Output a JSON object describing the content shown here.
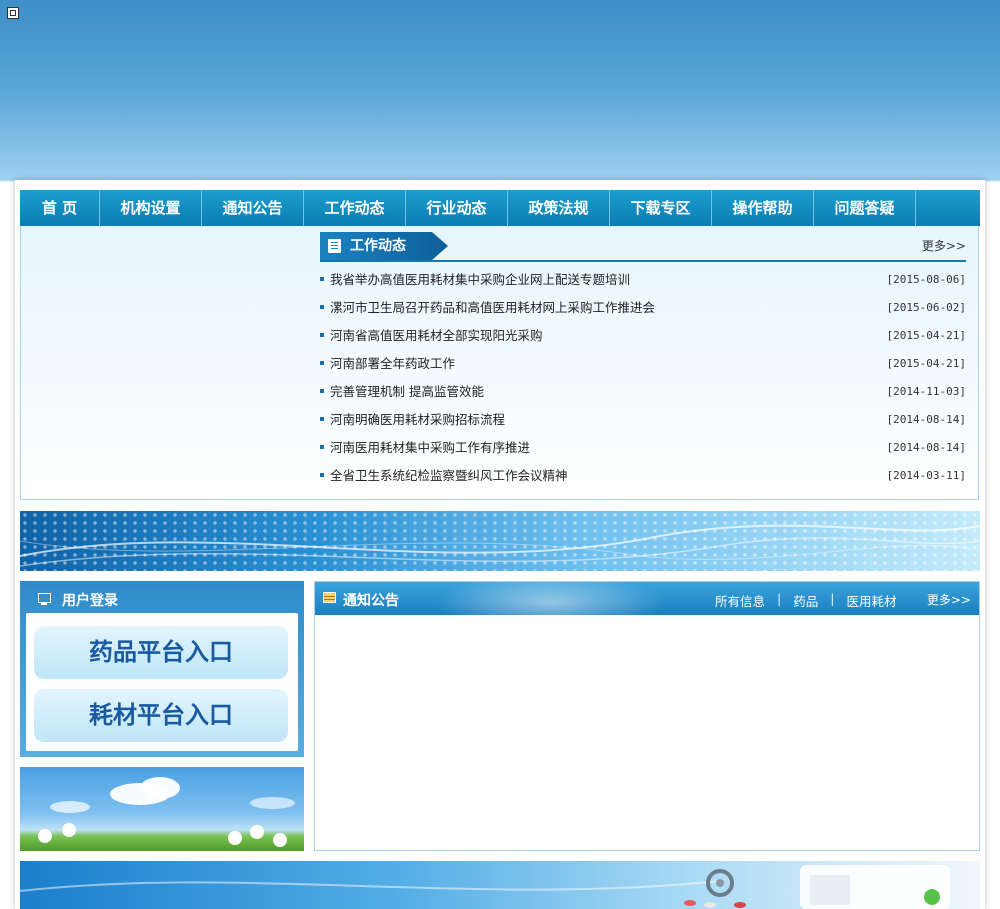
{
  "nav": {
    "items": [
      "首 页",
      "机构设置",
      "通知公告",
      "工作动态",
      "行业动态",
      "政策法规",
      "下载专区",
      "操作帮助",
      "问题答疑"
    ]
  },
  "news": {
    "title": "工作动态",
    "more": "更多>>",
    "items": [
      {
        "title": "我省举办高值医用耗材集中采购企业网上配送专题培训",
        "date": "[2015-08-06]"
      },
      {
        "title": "漯河市卫生局召开药品和高值医用耗材网上采购工作推进会",
        "date": "[2015-06-02]"
      },
      {
        "title": "河南省高值医用耗材全部实现阳光采购",
        "date": "[2015-04-21]"
      },
      {
        "title": "河南部署全年药政工作",
        "date": "[2015-04-21]"
      },
      {
        "title": "完善管理机制 提高监管效能",
        "date": "[2014-11-03]"
      },
      {
        "title": "河南明确医用耗材采购招标流程",
        "date": "[2014-08-14]"
      },
      {
        "title": "河南医用耗材集中采购工作有序推进",
        "date": "[2014-08-14]"
      },
      {
        "title": "全省卫生系统纪检监察暨纠风工作会议精神",
        "date": "[2014-03-11]"
      }
    ]
  },
  "login": {
    "title": "用户登录",
    "drug_entry": "药品平台入口",
    "consumable_entry": "耗材平台入口"
  },
  "notice": {
    "title": "通知公告",
    "links": [
      "所有信息",
      "药品",
      "医用耗材"
    ],
    "separator": "|",
    "more": "更多>>"
  },
  "colors": {
    "nav_bg": "#0f86bd",
    "accent": "#1479ad",
    "entry_text": "#1a5aa0"
  }
}
